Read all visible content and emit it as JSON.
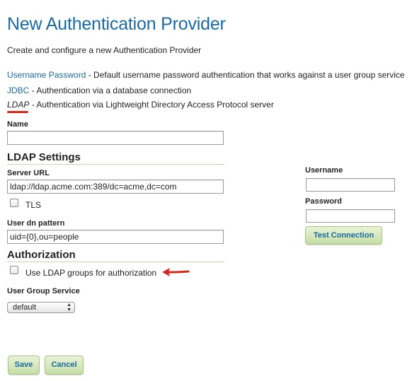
{
  "page": {
    "title": "New Authentication Provider",
    "subtitle": "Create and configure a new Authentication Provider"
  },
  "providers": [
    {
      "link": "Username Password",
      "description": " - Default username password authentication that works against a user group service"
    },
    {
      "link": "JDBC",
      "description": " - Authentication via a database connection"
    },
    {
      "link": "LDAP",
      "description": " - Authentication via Lightweight Directory Access Protocol server",
      "selected": true
    }
  ],
  "form": {
    "name_label": "Name",
    "name_value": "",
    "ldap_settings_heading": "LDAP Settings",
    "server_url_label": "Server URL",
    "server_url_value": "ldap://ldap.acme.com:389/dc=acme,dc=com",
    "tls_label": "TLS",
    "tls_checked": false,
    "user_dn_label": "User dn pattern",
    "user_dn_value": "uid={0},ou=people",
    "authorization_heading": "Authorization",
    "use_ldap_groups_label": "Use LDAP groups for authorization",
    "use_ldap_groups_checked": false,
    "user_group_service_label": "User Group Service",
    "user_group_service_value": "default"
  },
  "test_panel": {
    "username_label": "Username",
    "username_value": "",
    "password_label": "Password",
    "password_value": "",
    "test_button": "Test Connection"
  },
  "actions": {
    "save": "Save",
    "cancel": "Cancel"
  },
  "annotation_colors": {
    "accent_red": "#d9261c",
    "link_blue": "#1a6aa5"
  },
  "icons": [
    "red-underline-annotation",
    "red-arrow-annotation",
    "select-arrows-icon"
  ]
}
